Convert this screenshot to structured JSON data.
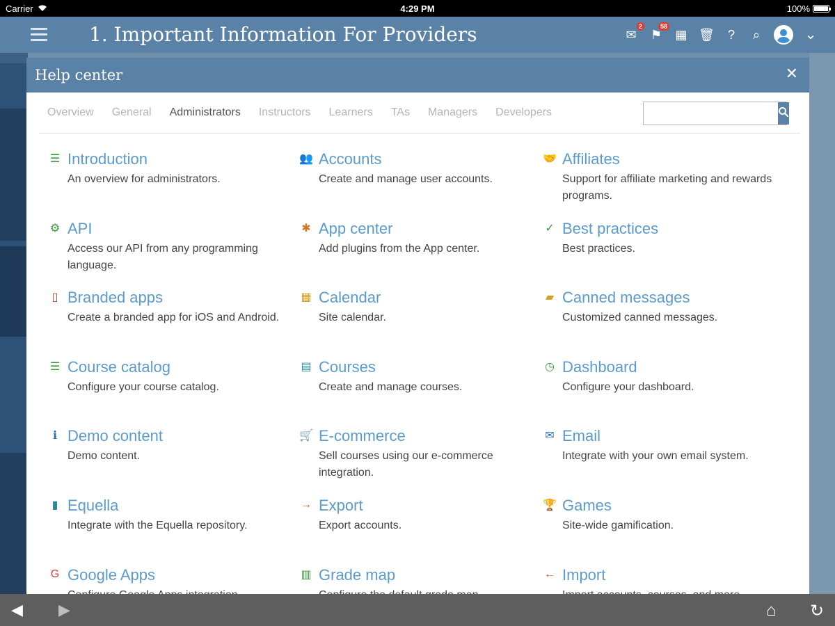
{
  "status_bar": {
    "carrier": "Carrier",
    "time": "4:29 PM",
    "battery": "100%"
  },
  "header": {
    "title": "1. Important Information For Providers",
    "icons": [
      {
        "name": "inbox-icon",
        "glyph": "✉",
        "badge": "2"
      },
      {
        "name": "notifications-icon",
        "glyph": "⚑",
        "badge": "58"
      },
      {
        "name": "calendar-icon",
        "glyph": "▦",
        "badge": ""
      },
      {
        "name": "trash-icon",
        "glyph": "🗑",
        "badge": ""
      },
      {
        "name": "help-icon",
        "glyph": "?",
        "badge": ""
      },
      {
        "name": "search-icon",
        "glyph": "⌕",
        "badge": ""
      }
    ],
    "dropdown_glyph": "⌄"
  },
  "modal": {
    "title": "Help center",
    "close_glyph": "✕",
    "tabs": [
      "Overview",
      "General",
      "Administrators",
      "Instructors",
      "Learners",
      "TAs",
      "Managers",
      "Developers"
    ],
    "active_tab": "Administrators",
    "search_placeholder": "",
    "search_glyph": "⌕",
    "items": [
      {
        "title": "Introduction",
        "desc": "An overview for administrators.",
        "icon": "list-icon",
        "glyph": "☰",
        "color": "#3a9a3a"
      },
      {
        "title": "Accounts",
        "desc": "Create and manage user accounts.",
        "icon": "users-icon",
        "glyph": "👥",
        "color": "#2a6fb0"
      },
      {
        "title": "Affiliates",
        "desc": "Support for affiliate marketing and rewards programs.",
        "icon": "handshake-icon",
        "glyph": "🤝",
        "color": "#2a6fb0"
      },
      {
        "title": "API",
        "desc": "Access our API from any programming language.",
        "icon": "gear-icon",
        "glyph": "⚙",
        "color": "#3a9a3a"
      },
      {
        "title": "App center",
        "desc": "Add plugins from the App center.",
        "icon": "puzzle-icon",
        "glyph": "✱",
        "color": "#d07a2a"
      },
      {
        "title": "Best practices",
        "desc": "Best practices.",
        "icon": "check-icon",
        "glyph": "✓",
        "color": "#3a9a3a"
      },
      {
        "title": "Branded apps",
        "desc": "Create a branded app for iOS and Android.",
        "icon": "mobile-icon",
        "glyph": "▯",
        "color": "#d0432a"
      },
      {
        "title": "Calendar",
        "desc": "Site calendar.",
        "icon": "calendar-icon",
        "glyph": "▦",
        "color": "#d8a020"
      },
      {
        "title": "Canned messages",
        "desc": "Customized canned messages.",
        "icon": "chat-icon",
        "glyph": "▰",
        "color": "#d8a020"
      },
      {
        "title": "Course catalog",
        "desc": "Configure your course catalog.",
        "icon": "list-icon",
        "glyph": "☰",
        "color": "#3a9a3a"
      },
      {
        "title": "Courses",
        "desc": "Create and manage courses.",
        "icon": "book-icon",
        "glyph": "▤",
        "color": "#2a8a9a"
      },
      {
        "title": "Dashboard",
        "desc": "Configure your dashboard.",
        "icon": "dashboard-icon",
        "glyph": "◷",
        "color": "#3a9a3a"
      },
      {
        "title": "Demo content",
        "desc": "Demo content.",
        "icon": "info-icon",
        "glyph": "ℹ",
        "color": "#2a6fb0"
      },
      {
        "title": "E-commerce",
        "desc": "Sell courses using our e-commerce integration.",
        "icon": "cart-icon",
        "glyph": "🛒",
        "color": "#d8a020"
      },
      {
        "title": "Email",
        "desc": "Integrate with your own email system.",
        "icon": "envelope-icon",
        "glyph": "✉",
        "color": "#2a6fb0"
      },
      {
        "title": "Equella",
        "desc": "Integrate with the Equella repository.",
        "icon": "equella-icon",
        "glyph": "▮",
        "color": "#2a8a9a"
      },
      {
        "title": "Export",
        "desc": "Export accounts.",
        "icon": "arrow-right-icon",
        "glyph": "→",
        "color": "#c05a2a"
      },
      {
        "title": "Games",
        "desc": "Site-wide gamification.",
        "icon": "trophy-icon",
        "glyph": "🏆",
        "color": "#d8a020"
      },
      {
        "title": "Google Apps",
        "desc": "Configure Google Apps integration.",
        "icon": "google-icon",
        "glyph": "G",
        "color": "#d0432a"
      },
      {
        "title": "Grade map",
        "desc": "Configure the default grade map.",
        "icon": "bar-chart-icon",
        "glyph": "▥",
        "color": "#3a9a3a"
      },
      {
        "title": "Import",
        "desc": "Import accounts, courses, and more.",
        "icon": "arrow-left-icon",
        "glyph": "←",
        "color": "#c05a2a"
      }
    ]
  },
  "bottom_bar": {
    "back_glyph": "◀",
    "forward_glyph": "▶",
    "home_glyph": "⌂",
    "reload_glyph": "↻"
  }
}
